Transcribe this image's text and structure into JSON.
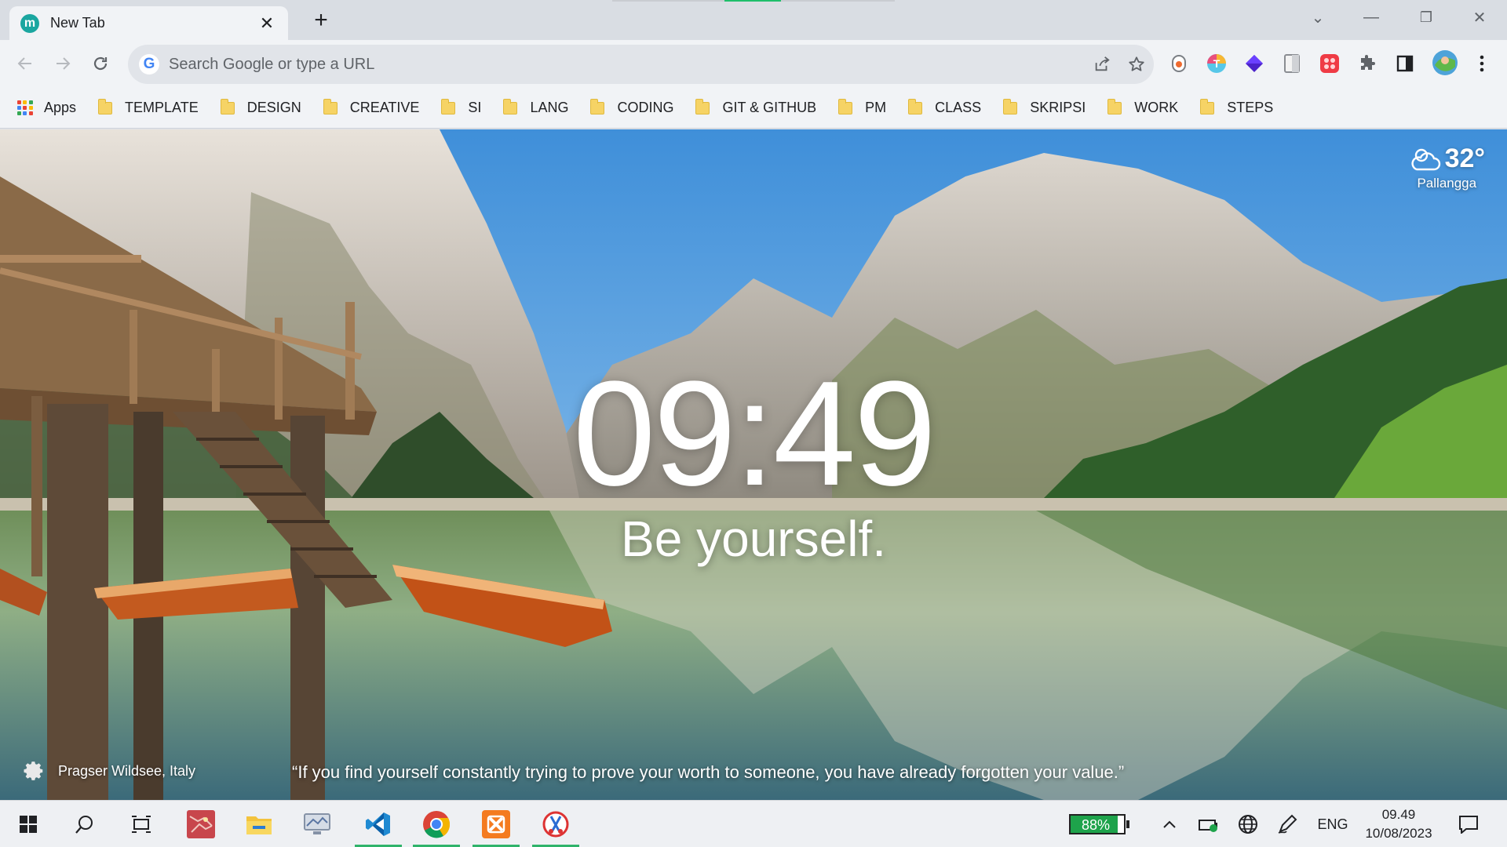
{
  "tab": {
    "title": "New Tab",
    "favicon_letter": "m",
    "close_glyph": "✕",
    "new_tab_glyph": "+"
  },
  "window": {
    "dropdown_glyph": "⌄",
    "minimize_glyph": "—",
    "restore_glyph": "❐",
    "close_glyph": "✕"
  },
  "toolbar": {
    "omnibox_placeholder": "Search Google or type a URL",
    "g_letter": "G"
  },
  "bookmarks": {
    "apps_label": "Apps",
    "items": [
      "TEMPLATE",
      "DESIGN",
      "CREATIVE",
      "SI",
      "LANG",
      "CODING",
      "GIT & GITHUB",
      "PM",
      "CLASS",
      "SKRIPSI",
      "WORK",
      "STEPS"
    ]
  },
  "newtab": {
    "weather_temp": "32°",
    "weather_location": "Pallangga",
    "clock": "09:49",
    "greeting": "Be yourself.",
    "photo_location": "Pragser Wildsee, Italy",
    "quote": "“If you find yourself constantly trying to prove your worth to someone, you have already forgotten your value.”"
  },
  "taskbar": {
    "battery_percent": "88%",
    "battery_level": 0.88,
    "language": "ENG",
    "time": "09.49",
    "date": "10/08/2023"
  },
  "colors": {
    "accent_green": "#2fb36a",
    "tab_favicon": "#1aa6a0",
    "battery": "#1ea34b"
  }
}
